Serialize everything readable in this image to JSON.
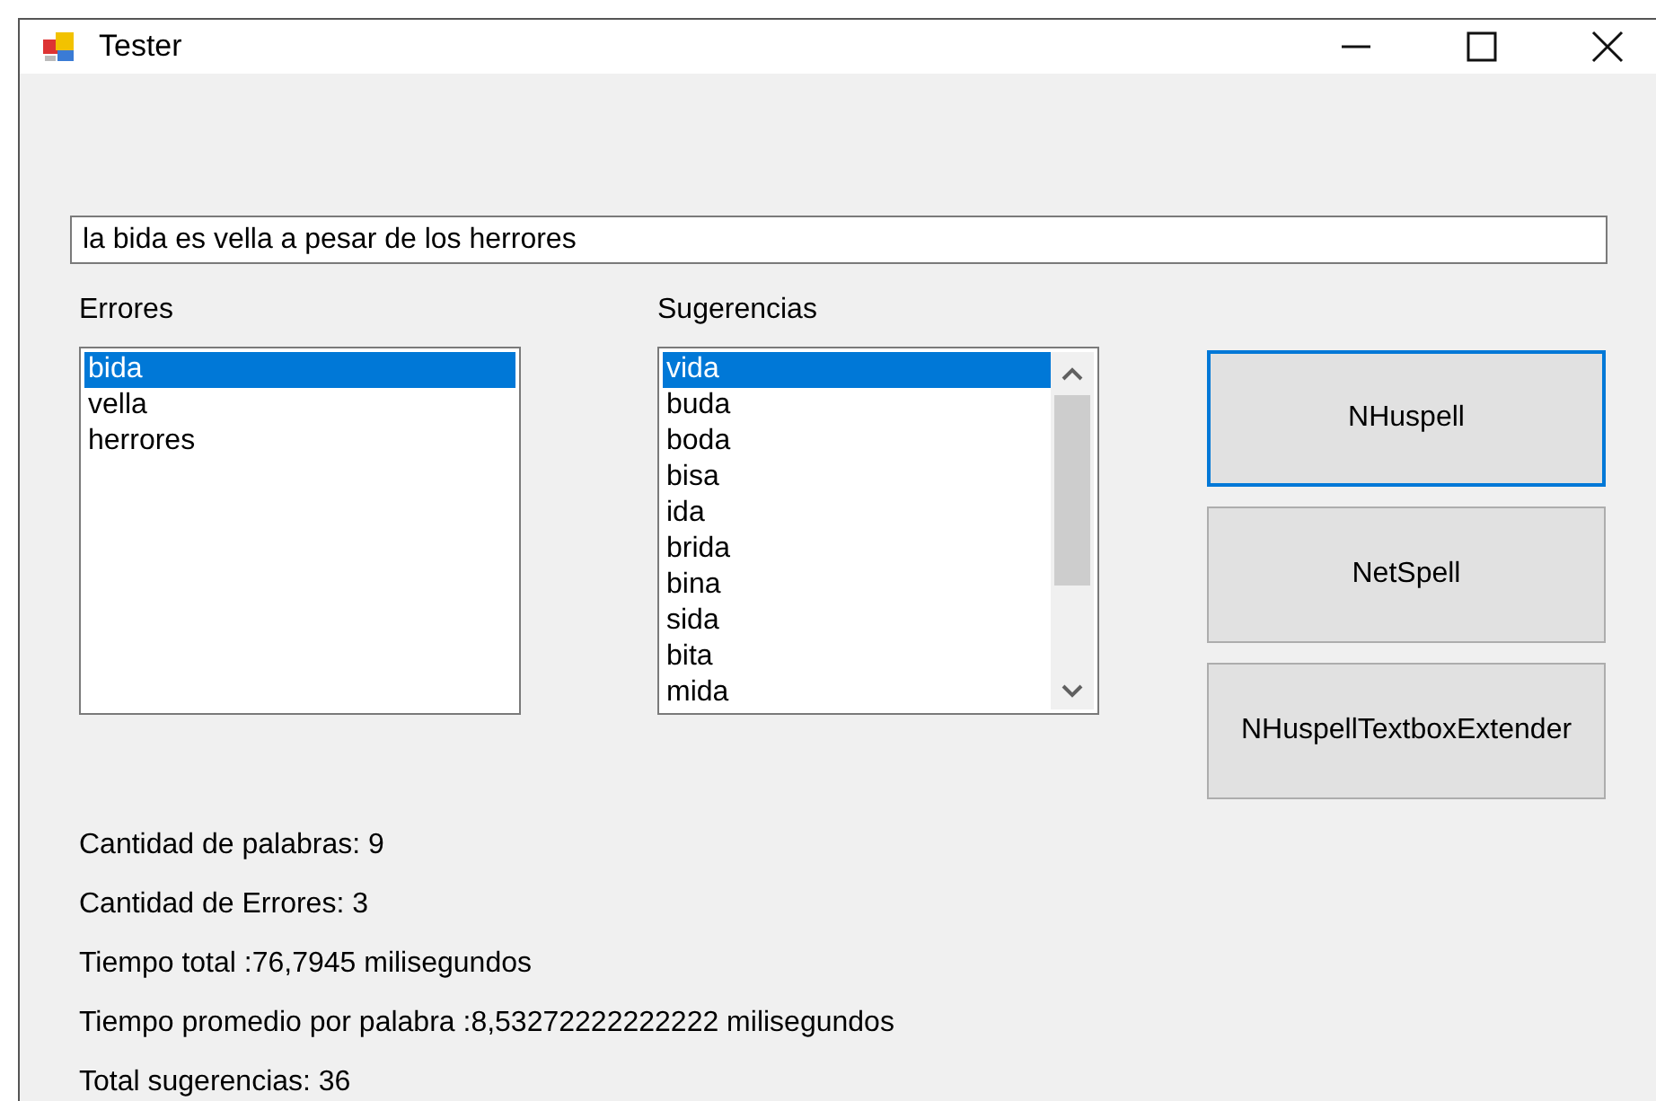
{
  "window": {
    "title": "Tester"
  },
  "input": {
    "value": "la bida es vella a pesar de los herrores"
  },
  "errors": {
    "label": "Errores",
    "items": [
      {
        "text": "bida",
        "selected": true
      },
      {
        "text": "vella",
        "selected": false
      },
      {
        "text": "herrores",
        "selected": false
      }
    ]
  },
  "suggestions": {
    "label": "Sugerencias",
    "items": [
      {
        "text": "vida",
        "selected": true
      },
      {
        "text": "buda",
        "selected": false
      },
      {
        "text": "boda",
        "selected": false
      },
      {
        "text": "bisa",
        "selected": false
      },
      {
        "text": "ida",
        "selected": false
      },
      {
        "text": "brida",
        "selected": false
      },
      {
        "text": "bina",
        "selected": false
      },
      {
        "text": "sida",
        "selected": false
      },
      {
        "text": "bita",
        "selected": false
      },
      {
        "text": "mida",
        "selected": false
      }
    ]
  },
  "buttons": [
    {
      "label": "NHuspell",
      "focused": true
    },
    {
      "label": "NetSpell",
      "focused": false
    },
    {
      "label": "NHuspellTextboxExtender",
      "focused": false
    }
  ],
  "stats": [
    "Cantidad de palabras: 9",
    "Cantidad de Errores: 3",
    "Tiempo total :76,7945 milisegundos",
    "Tiempo promedio por palabra :8,53272222222222 milisegundos",
    "Total sugerencias: 36"
  ]
}
